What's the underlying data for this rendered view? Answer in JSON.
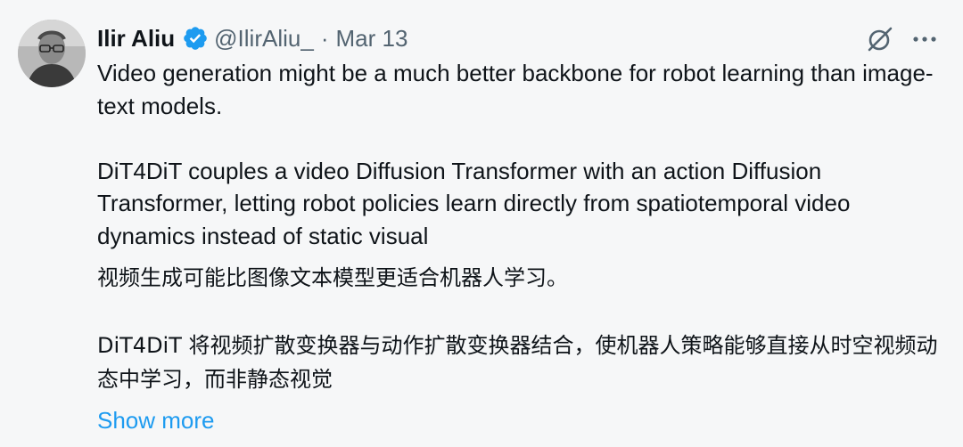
{
  "author": {
    "name": "Ilir Aliu",
    "handle": "@IlirAliu_",
    "separator": "·",
    "date": "Mar 13"
  },
  "body": {
    "paragraph_1": "Video generation might be a much better backbone for robot learning than image-text models.",
    "paragraph_2": "DiT4DiT couples a video Diffusion Transformer with an action Diffusion Transformer, letting robot policies learn directly from spatiotemporal video dynamics instead of static visual",
    "translation_1": "视频生成可能比图像文本模型更适合机器人学习。",
    "translation_2": "DiT4DiT 将视频扩散变换器与动作扩散变换器结合，使机器人策略能够直接从时空视频动态中学习，而非静态视觉"
  },
  "actions": {
    "show_more": "Show more"
  },
  "colors": {
    "link": "#1d9bf0",
    "verified_badge": "#1d9bf0",
    "secondary_text": "#536471",
    "background": "#f6f7f8"
  },
  "icons": {
    "verified": "verified-badge-icon",
    "grok": "grok-icon",
    "more": "more-options-icon"
  }
}
